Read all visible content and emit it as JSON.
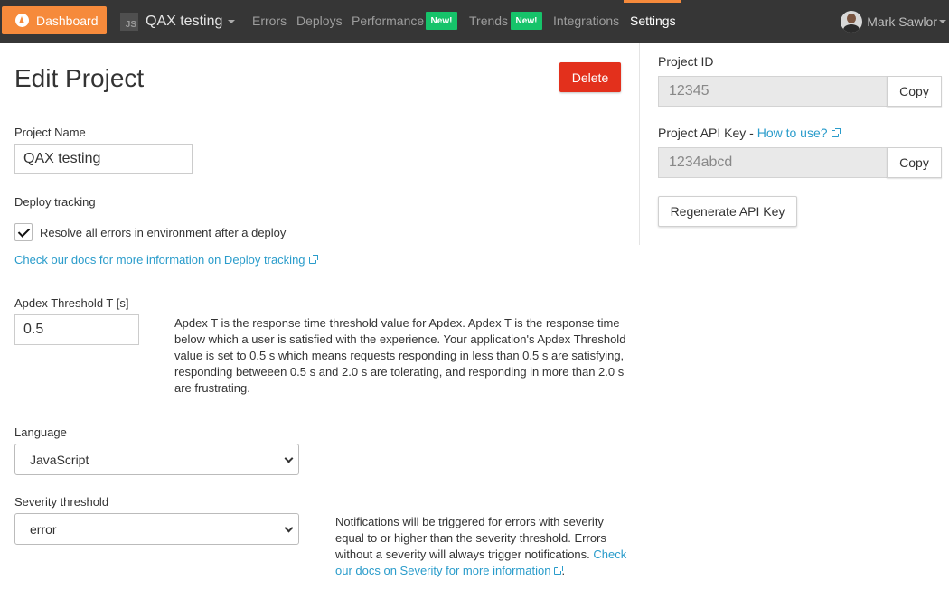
{
  "nav": {
    "dashboard_label": "Dashboard",
    "project_name": "QAX testing",
    "project_icon_text": "JS",
    "items": [
      {
        "label": "Errors"
      },
      {
        "label": "Deploys"
      },
      {
        "label": "Performance",
        "badge": "New!"
      },
      {
        "label": "Trends",
        "badge": "New!"
      },
      {
        "label": "Integrations"
      },
      {
        "label": "Settings",
        "active": true
      }
    ],
    "user_name": "Mark Sawlor"
  },
  "page": {
    "title": "Edit Project",
    "delete_label": "Delete"
  },
  "form": {
    "project_name_label": "Project Name",
    "project_name_value": "QAX testing",
    "deploy_tracking_label": "Deploy tracking",
    "resolve_checkbox_label": "Resolve all errors in environment after a deploy",
    "resolve_checked": true,
    "deploy_docs_link": "Check our docs for more information on Deploy tracking",
    "apdex_label": "Apdex Threshold T [s]",
    "apdex_value": "0.5",
    "apdex_description": "Apdex T is the response time threshold value for Apdex. Apdex T is the response time below which a user is satisfied with the experience. Your application's Apdex Threshold value is set to 0.5 s which means requests responding in less than 0.5 s are satisfying, responding betweeen 0.5 s and 2.0 s are tolerating, and responding in more than 2.0 s are frustrating.",
    "language_label": "Language",
    "language_value": "JavaScript",
    "severity_label": "Severity threshold",
    "severity_value": "error",
    "severity_description": "Notifications will be triggered for errors with severity equal to or higher than the severity threshold. Errors without a severity will always trigger notifications.",
    "severity_docs_link": "Check our docs on Severity for more information",
    "severity_period": "."
  },
  "sidebar": {
    "project_id_label": "Project ID",
    "project_id_value": "12345",
    "api_key_label": "Project API Key - ",
    "how_to_use_link": "How to use?",
    "api_key_value": "1234abcd",
    "copy_label": "Copy",
    "regenerate_label": "Regenerate API Key"
  },
  "colors": {
    "accent": "#f68a3b",
    "link": "#2a9ccb",
    "danger": "#e3301c",
    "badge": "#16c36a",
    "nav_bg": "#363636"
  }
}
